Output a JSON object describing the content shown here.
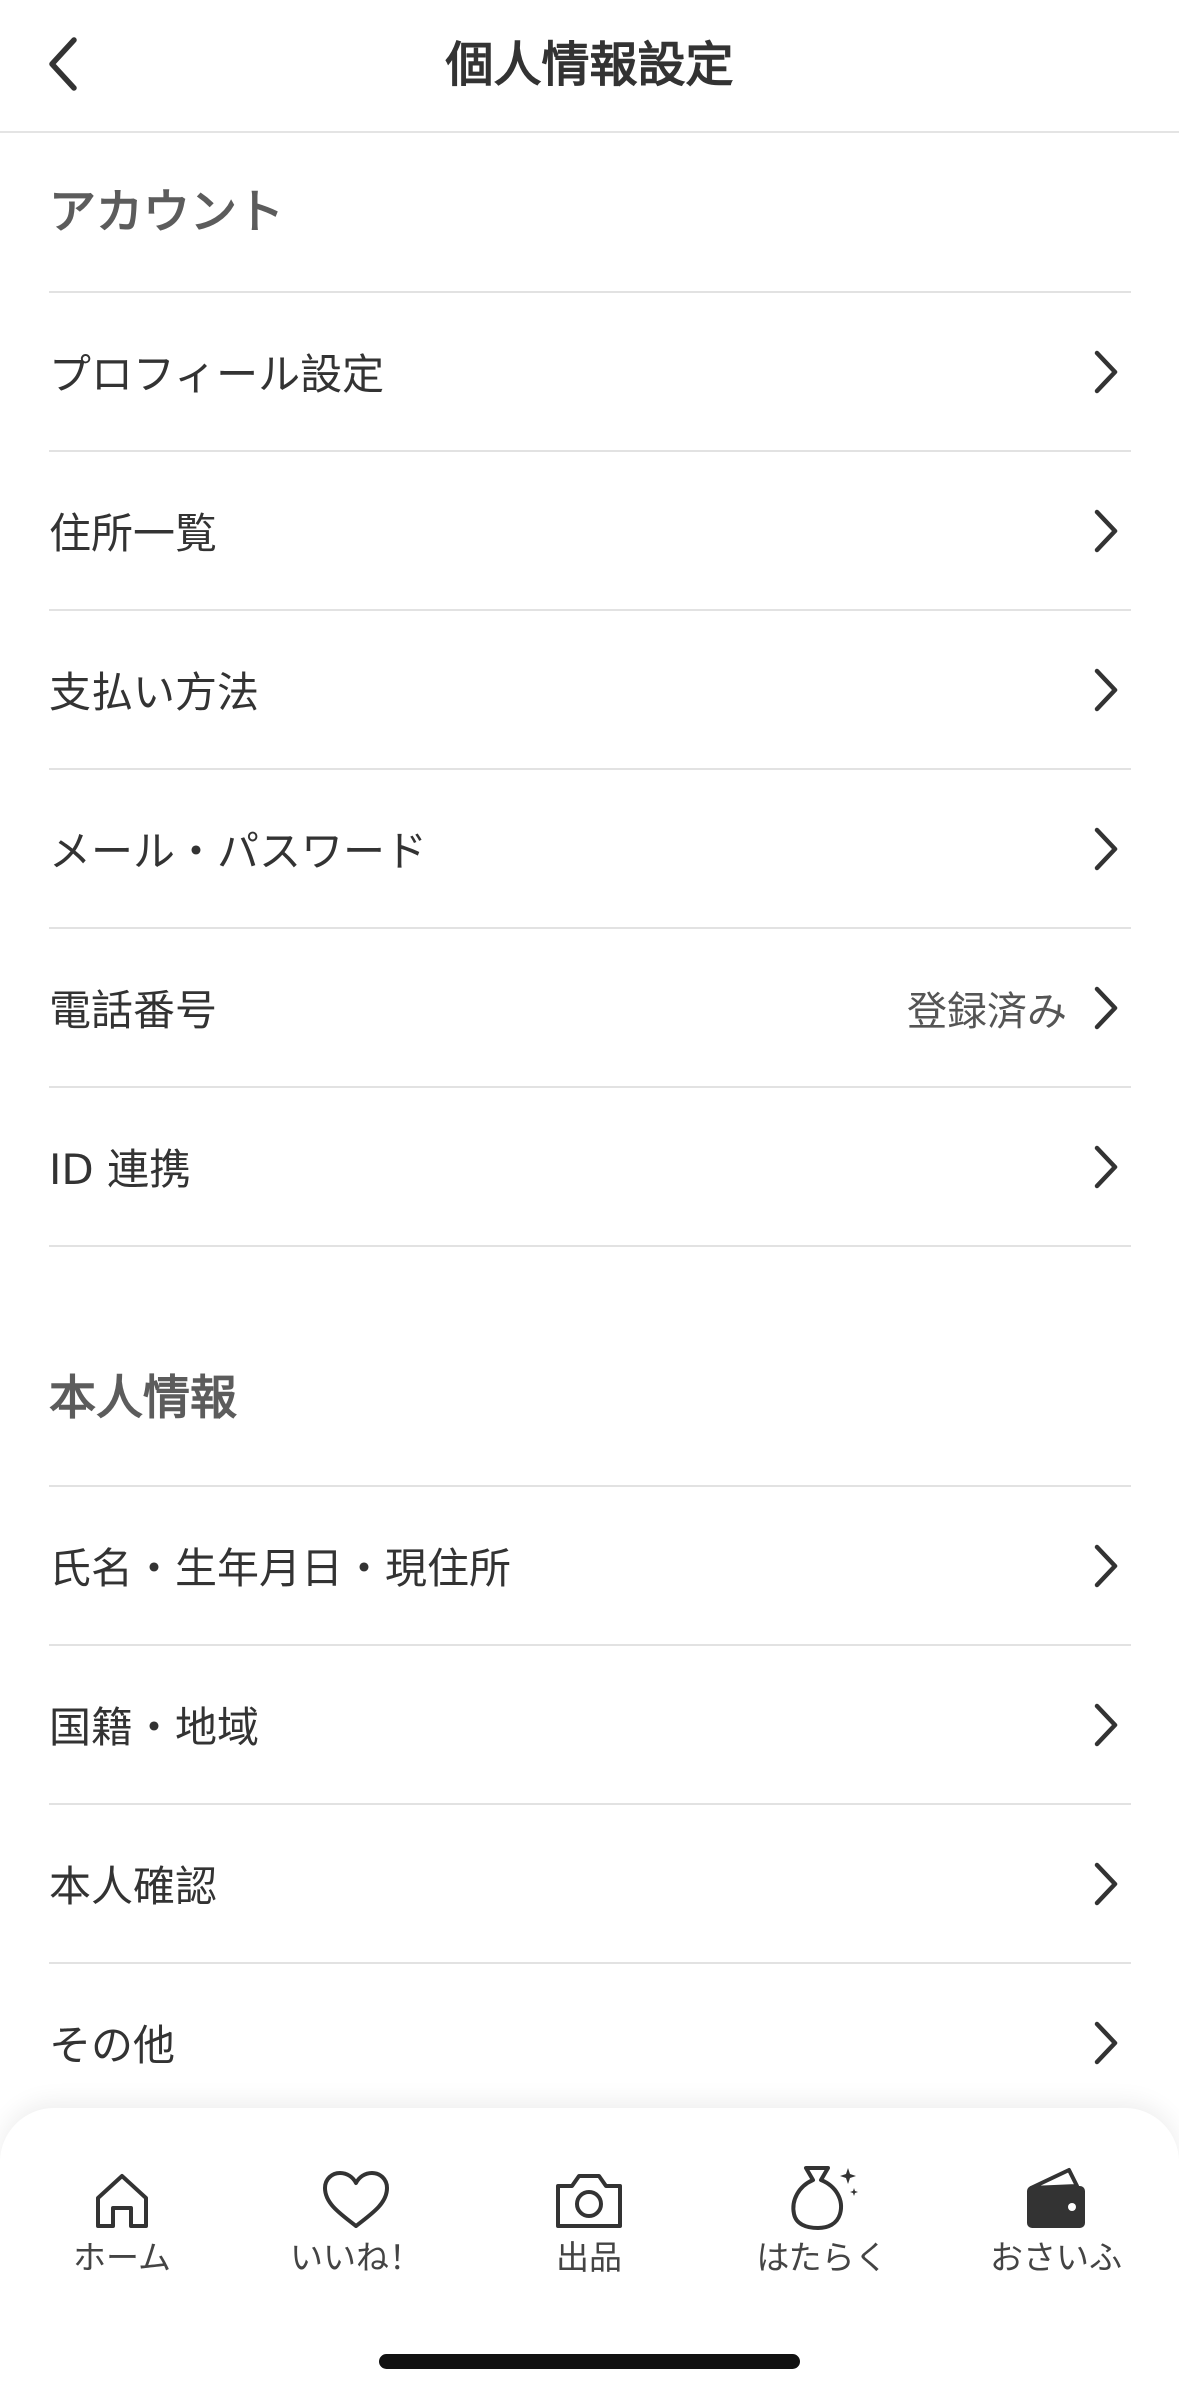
{
  "header": {
    "title": "個人情報設定",
    "back_icon": "chevron-left-icon"
  },
  "sections": [
    {
      "title": "アカウント",
      "rows": [
        {
          "label": "プロフィール設定",
          "value": ""
        },
        {
          "label": "住所一覧",
          "value": ""
        },
        {
          "label": "支払い方法",
          "value": ""
        },
        {
          "label": "メール・パスワード",
          "value": ""
        },
        {
          "label": "電話番号",
          "value": "登録済み"
        },
        {
          "label": "ID 連携",
          "value": ""
        }
      ]
    },
    {
      "title": "本人情報",
      "rows": [
        {
          "label": "氏名・生年月日・現住所",
          "value": ""
        },
        {
          "label": "国籍・地域",
          "value": ""
        },
        {
          "label": "本人確認",
          "value": ""
        },
        {
          "label": "その他",
          "value": ""
        }
      ]
    }
  ],
  "tabbar": {
    "items": [
      {
        "label": "ホーム",
        "icon": "home-icon"
      },
      {
        "label": "いいね！",
        "icon": "heart-icon"
      },
      {
        "label": "出品",
        "icon": "camera-icon"
      },
      {
        "label": "はたらく",
        "icon": "money-bag-icon"
      },
      {
        "label": "おさいふ",
        "icon": "wallet-icon"
      }
    ]
  },
  "colors": {
    "text": "#333333",
    "section_title": "#5c5c5c",
    "divider": "#e2e2e2",
    "background": "#ffffff"
  }
}
